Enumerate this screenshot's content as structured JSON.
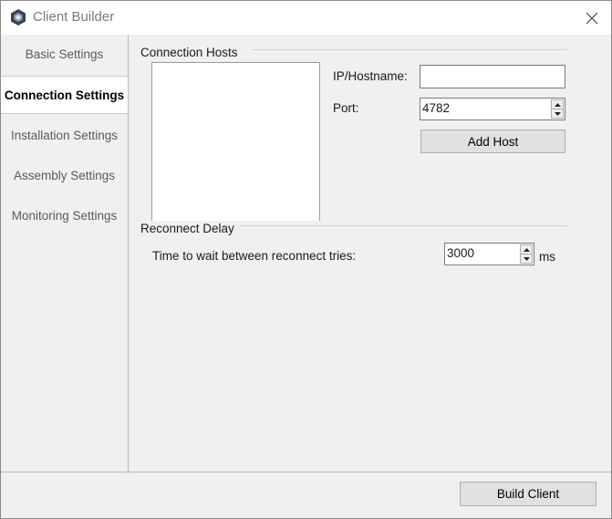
{
  "window": {
    "title": "Client Builder"
  },
  "sidebar": {
    "items": [
      {
        "label": "Basic Settings",
        "active": false
      },
      {
        "label": "Connection Settings",
        "active": true
      },
      {
        "label": "Installation Settings",
        "active": false
      },
      {
        "label": "Assembly Settings",
        "active": false
      },
      {
        "label": "Monitoring Settings",
        "active": false
      }
    ]
  },
  "connection_hosts": {
    "title": "Connection Hosts",
    "hosts": [],
    "ip_label": "IP/Hostname:",
    "ip_value": "",
    "port_label": "Port:",
    "port_value": "4782",
    "add_host_label": "Add Host"
  },
  "reconnect_delay": {
    "title": "Reconnect Delay",
    "wait_label": "Time to wait between reconnect tries:",
    "wait_value": "3000",
    "unit": "ms"
  },
  "footer": {
    "build_label": "Build Client"
  }
}
